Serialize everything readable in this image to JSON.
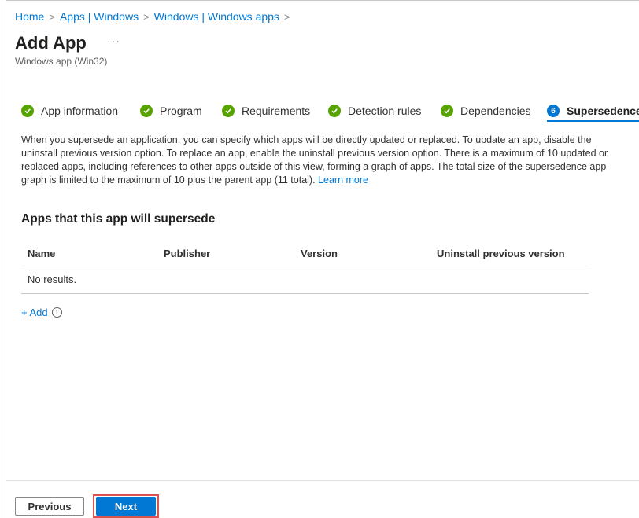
{
  "breadcrumb": {
    "home": "Home",
    "apps_windows": "Apps | Windows",
    "windows_apps": "Windows | Windows apps"
  },
  "page": {
    "title": "Add App",
    "more": "···",
    "subtitle": "Windows app (Win32)"
  },
  "tabs": [
    {
      "label": "App information",
      "state": "complete"
    },
    {
      "label": "Program",
      "state": "complete"
    },
    {
      "label": "Requirements",
      "state": "complete"
    },
    {
      "label": "Detection rules",
      "state": "complete"
    },
    {
      "label": "Dependencies",
      "state": "complete"
    },
    {
      "label": "Supersedence",
      "state": "active",
      "step": "6"
    }
  ],
  "description": {
    "text": "When you supersede an application, you can specify which apps will be directly updated or replaced. To update an app, disable the uninstall previous version option. To replace an app, enable the uninstall previous version option. There is a maximum of 10 updated or replaced apps, including references to other apps outside of this view, forming a graph of apps. The total size of the supersedence app graph is limited to the maximum of 10 plus the parent app (11 total).",
    "learn_more": "Learn more"
  },
  "supersede": {
    "title": "Apps that this app will supersede",
    "columns": [
      "Name",
      "Publisher",
      "Version",
      "Uninstall previous version"
    ],
    "empty": "No results.",
    "add": "+ Add",
    "info": "i"
  },
  "footer": {
    "previous": "Previous",
    "next": "Next"
  },
  "colors": {
    "accent": "#0078d4",
    "complete": "#57a300",
    "highlight_border": "#d9534f"
  }
}
